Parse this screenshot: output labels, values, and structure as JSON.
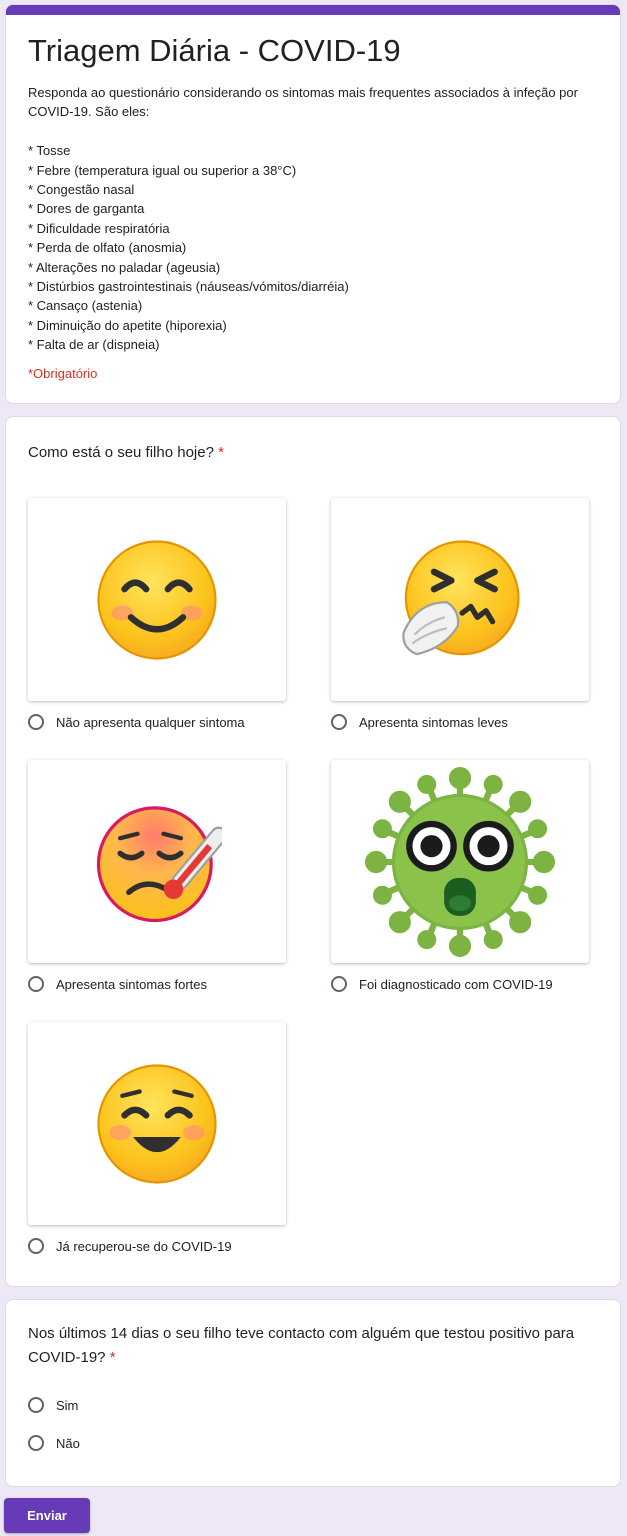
{
  "form": {
    "title": "Triagem Diária - COVID-19",
    "description_intro": "Responda ao questionário considerando os sintomas mais frequentes associados à infeção por COVID-19. São eles:",
    "symptoms": [
      "* Tosse",
      "* Febre (temperatura igual ou superior a 38°C)",
      "* Congestão nasal",
      "* Dores de garganta",
      "* Dificuldade respiratória",
      "* Perda de olfato (anosmia)",
      "* Alterações no paladar (ageusia)",
      "* Distúrbios gastrointestinais (náuseas/vómitos/diarréia)",
      "* Cansaço (astenia)",
      "* Diminuição do apetite (hiporexia)",
      "* Falta de ar (dispneia)"
    ],
    "required_note": "*Obrigatório",
    "accent_color": "#673ab7",
    "required_color": "#d93025",
    "background_color": "#ede7f6"
  },
  "question1": {
    "title": "Como está o seu filho hoje?",
    "required_mark": "*",
    "options": [
      {
        "label": "Não apresenta qualquer sintoma",
        "image_icon": "smiling-face-icon"
      },
      {
        "label": "Apresenta sintomas leves",
        "image_icon": "sneezing-face-icon"
      },
      {
        "label": "Apresenta sintomas fortes",
        "image_icon": "face-with-thermometer-icon"
      },
      {
        "label": "Foi diagnosticado com COVID-19",
        "image_icon": "virus-icon"
      },
      {
        "label": "Já recuperou-se do COVID-19",
        "image_icon": "relieved-face-icon"
      }
    ]
  },
  "question2": {
    "title": "Nos últimos 14 dias o seu filho teve contacto com alguém que testou positivo para COVID-19?",
    "required_mark": "*",
    "options": [
      {
        "label": "Sim"
      },
      {
        "label": "Não"
      }
    ]
  },
  "submit": {
    "label": "Enviar"
  }
}
